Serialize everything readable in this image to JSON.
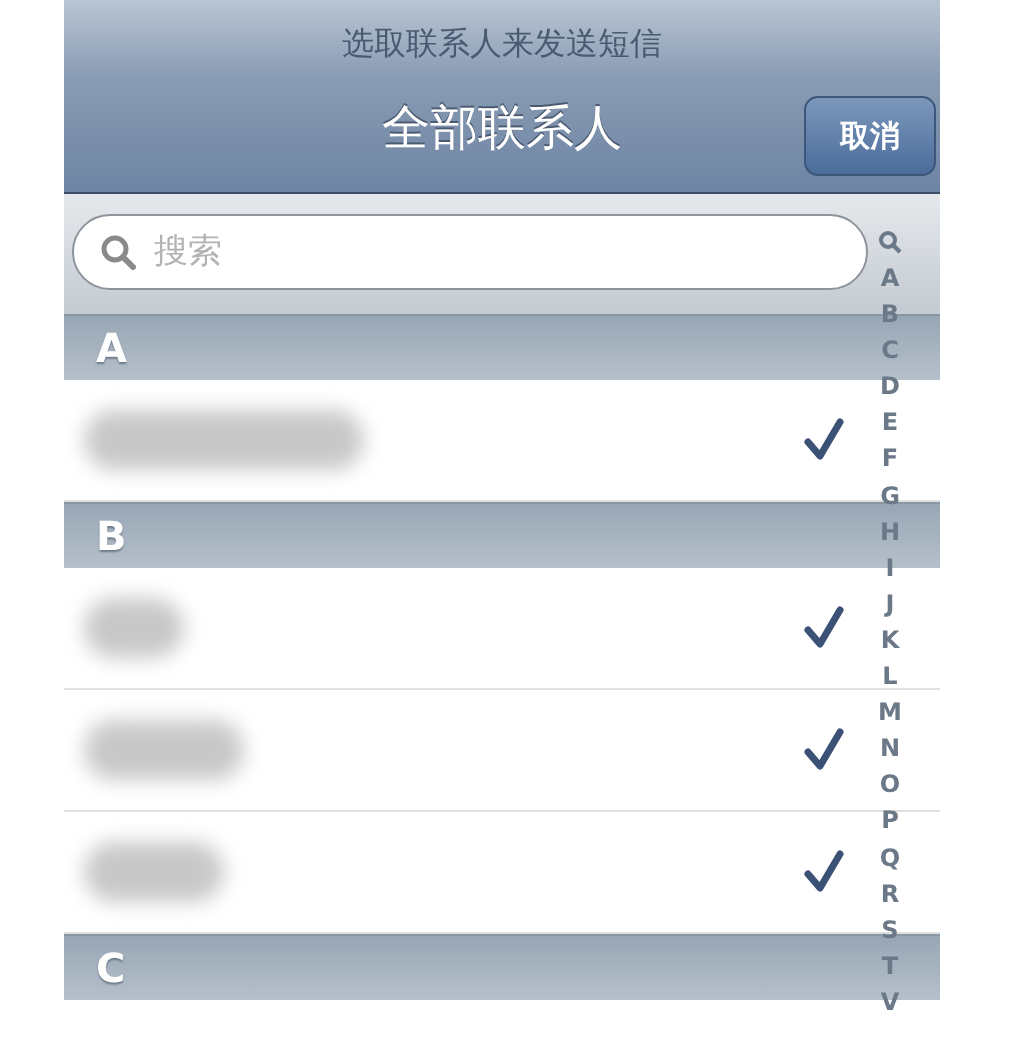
{
  "header": {
    "prompt": "选取联系人来发送短信",
    "title": "全部联系人",
    "cancel_button": "取消"
  },
  "search": {
    "placeholder": "搜索"
  },
  "sections": [
    {
      "letter": "A",
      "contacts": [
        {
          "checked": true
        }
      ]
    },
    {
      "letter": "B",
      "contacts": [
        {
          "checked": true
        },
        {
          "checked": true
        },
        {
          "checked": true
        }
      ]
    },
    {
      "letter": "C"
    }
  ],
  "index": [
    "A",
    "B",
    "C",
    "D",
    "E",
    "F",
    "G",
    "H",
    "I",
    "J",
    "K",
    "L",
    "M",
    "N",
    "O",
    "P",
    "Q",
    "R",
    "S",
    "T",
    "V"
  ]
}
